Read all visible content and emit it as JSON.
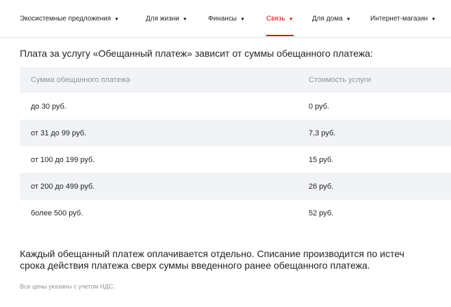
{
  "nav": {
    "items": [
      {
        "label": "Экосистемные предложения",
        "active": false
      },
      {
        "label": "Для жизни",
        "active": false
      },
      {
        "label": "Финансы",
        "active": false
      },
      {
        "label": "Связь",
        "active": true
      },
      {
        "label": "Для дома",
        "active": false
      },
      {
        "label": "Интернет-магазин",
        "active": false
      }
    ],
    "chevron_icon": "chevron-down-icon"
  },
  "intro_text": "Плата за услугу «Обещанный платеж» зависит от суммы обещанного платежа:",
  "table": {
    "headers": [
      "Сумма обещанного платежа",
      "Стоимость услуги"
    ],
    "rows": [
      [
        "до 30 руб.",
        "0 руб."
      ],
      [
        "от 31 до 99 руб.",
        "7,3 руб."
      ],
      [
        "от 100 до 199 руб.",
        "15 руб."
      ],
      [
        "от 200 до 499 руб.",
        "26 руб."
      ],
      [
        "более 500 руб.",
        "52 руб."
      ]
    ]
  },
  "note": {
    "line1": "Каждый обещанный платеж оплачивается отдельно. Списание производится по истеч",
    "line2": "срока действия платежа сверх суммы введенного ранее обещанного платежа."
  },
  "vat_text": "Все цены указаны с учетом НДС.",
  "colors": {
    "accent": "#e30611",
    "text": "#1d2023",
    "muted": "#8d969f",
    "row_alt": "#f2f3f7"
  }
}
